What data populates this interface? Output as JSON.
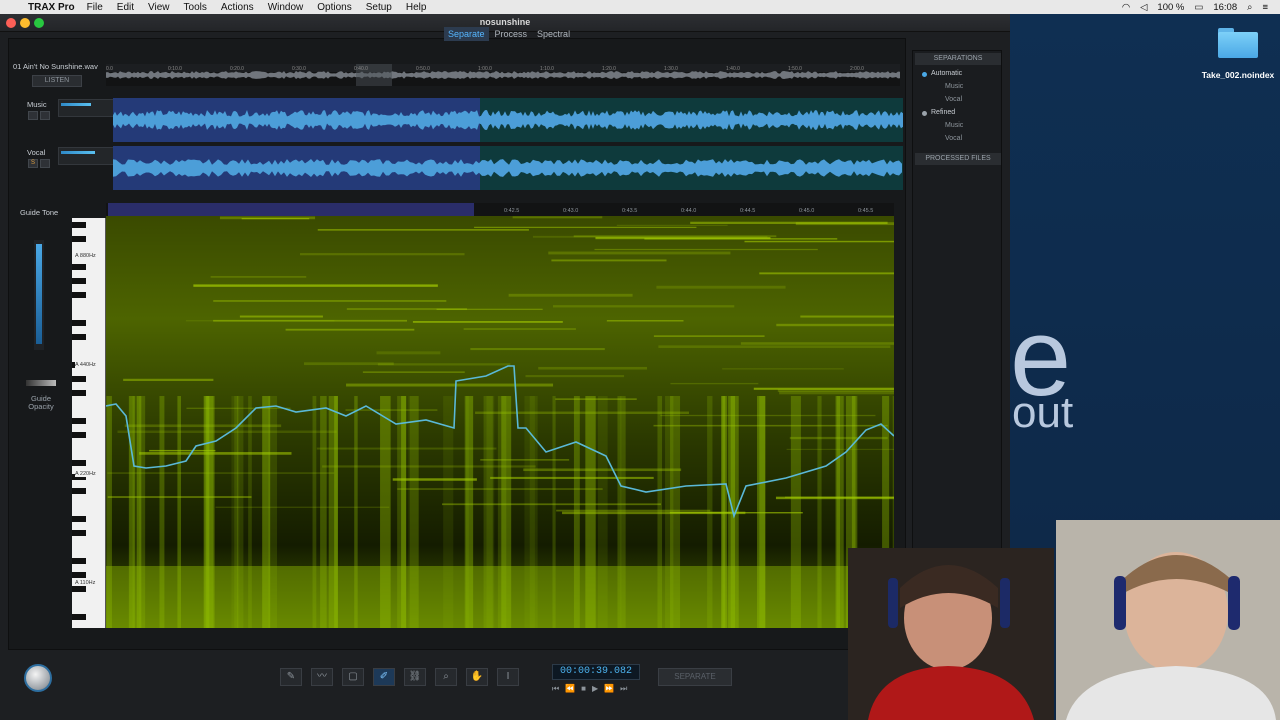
{
  "menubar": {
    "app": "TRAX Pro",
    "items": [
      "File",
      "Edit",
      "View",
      "Tools",
      "Actions",
      "Window",
      "Options",
      "Setup",
      "Help"
    ],
    "battery": "100 %",
    "clock": "16:08"
  },
  "window": {
    "title": "nosunshine"
  },
  "tabs": [
    "Separate",
    "Process",
    "Spectral"
  ],
  "file": {
    "name": "01 Ain't No Sunshine.wav",
    "listen_label": "LISTEN"
  },
  "overview_ticks": [
    "0.0",
    "0:10.0",
    "0:20.0",
    "0:30.0",
    "0:40.0",
    "0:50.0",
    "1:00.0",
    "1:10.0",
    "1:20.0",
    "1:30.0",
    "1:40.0",
    "1:50.0",
    "2:00.0"
  ],
  "tracks": [
    {
      "name": "Music",
      "solo": "S",
      "mute": ""
    },
    {
      "name": "Vocal",
      "solo": "S",
      "mute": ""
    }
  ],
  "spectral": {
    "guide_tone_label": "Guide Tone",
    "guide_opacity_label": "Guide Opacity",
    "ruler_ticks": [
      "0:39.5",
      "0:40.0",
      "0:40.5",
      "0:41.0",
      "0:41.5",
      "0:42.0",
      "0:42.5",
      "0:43.0",
      "0:43.5",
      "0:44.0",
      "0:44.5",
      "0:45.0",
      "0:45.5"
    ],
    "freq_labels": [
      "A 880Hz",
      "A 440Hz",
      "A 220Hz",
      "A 110Hz"
    ]
  },
  "transport": {
    "time": "00:00:39.082",
    "separate_label": "SEPARATE"
  },
  "separations": {
    "header": "SEPARATIONS",
    "groups": [
      {
        "label": "Automatic",
        "color": "#4aa8e6",
        "items": [
          "Music",
          "Vocal"
        ]
      },
      {
        "label": "Refined",
        "color": "#9aa2aa",
        "items": [
          "Music",
          "Vocal"
        ]
      }
    ],
    "processed_header": "PROCESSED FILES"
  },
  "desktop": {
    "folder_label": "Take_002.noindex",
    "big_letter": "e",
    "big_word": "out"
  },
  "colors": {
    "accent": "#56b6ff",
    "spectrum": "#b6e000",
    "pitch_line": "#5ab9d8"
  }
}
